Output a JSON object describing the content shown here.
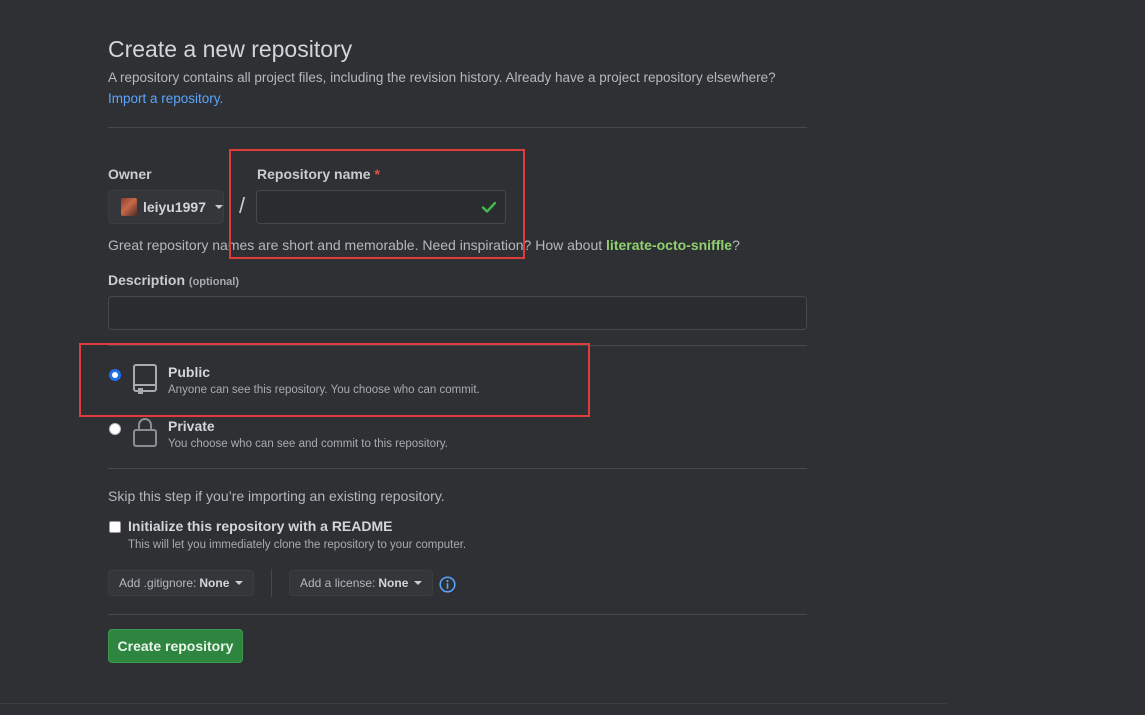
{
  "header": {
    "title": "Create a new repository",
    "subtitle": "A repository contains all project files, including the revision history. Already have a project repository elsewhere?",
    "import_link": "Import a repository."
  },
  "owner": {
    "label": "Owner",
    "value": "leiyu1997"
  },
  "repo_name": {
    "label": "Repository name",
    "required_mark": "*",
    "value": "",
    "slash": "/"
  },
  "hint": {
    "prefix": "Great repository names are short and memorable. Need inspiration? How about ",
    "suggestion": "literate-octo-sniffle",
    "suffix": "?"
  },
  "description": {
    "label": "Description",
    "optional": "(optional)",
    "value": ""
  },
  "visibility": {
    "selected": "public",
    "options": [
      {
        "title": "Public",
        "desc": "Anyone can see this repository. You choose who can commit."
      },
      {
        "title": "Private",
        "desc": "You choose who can see and commit to this repository."
      }
    ]
  },
  "init": {
    "skip_text": "Skip this step if you’re importing an existing repository.",
    "readme_label": "Initialize this repository with a README",
    "readme_desc": "This will let you immediately clone the repository to your computer.",
    "readme_checked": false
  },
  "gitignore": {
    "label": "Add .gitignore:",
    "value": "None"
  },
  "license": {
    "label": "Add a license:",
    "value": "None"
  },
  "submit": {
    "label": "Create repository"
  },
  "colors": {
    "accent_link": "#58a6ff",
    "create_button": "#2e8540",
    "highlight_box": "#e03c3c",
    "suggestion": "#8fd06f"
  }
}
